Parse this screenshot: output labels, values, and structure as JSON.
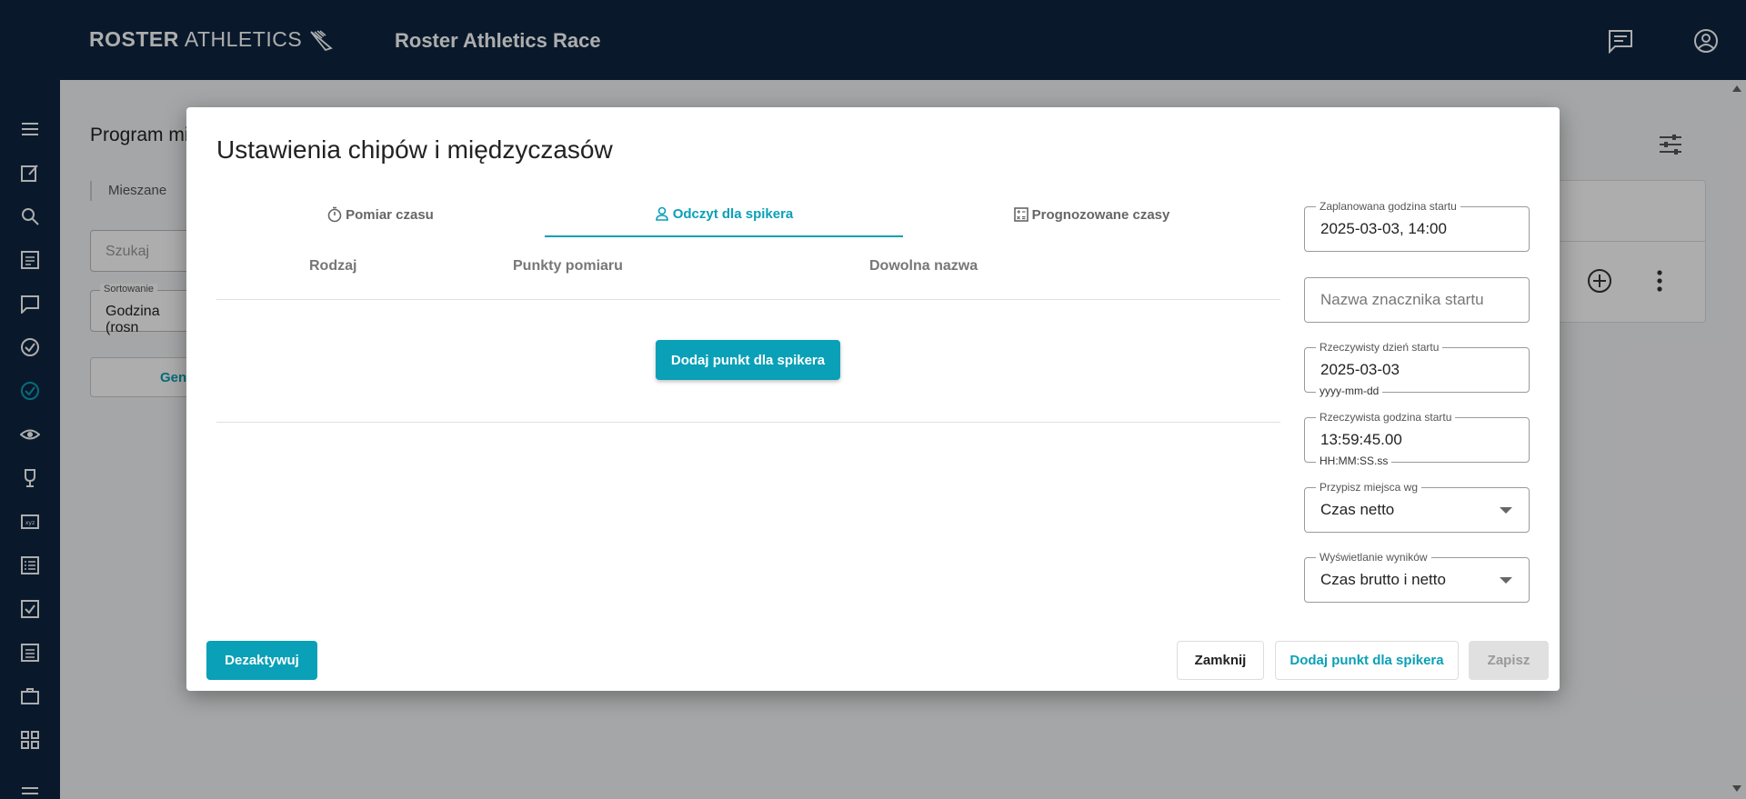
{
  "app": {
    "logo_bold": "ROSTER",
    "logo_light": "ATHLETICS",
    "race_title": "Roster Athletics Race"
  },
  "background": {
    "page_title": "Program mi",
    "tab_label": "Mieszane",
    "search_placeholder": "Szukaj",
    "sort_label": "Sortowanie",
    "sort_value": "Godzina (rosn",
    "generate_label": "Gene"
  },
  "modal": {
    "title": "Ustawienia chipów i międzyczasów",
    "tabs": [
      {
        "label": "Pomiar czasu",
        "icon": "stopwatch-icon",
        "active": false
      },
      {
        "label": "Odczyt dla spikera",
        "icon": "person-icon",
        "active": true
      },
      {
        "label": "Prognozowane czasy",
        "icon": "calculator-icon",
        "active": false
      }
    ],
    "columns": [
      "Rodzaj",
      "Punkty pomiaru",
      "Dowolna nazwa"
    ],
    "add_point_button": "Dodaj punkt dla spikera",
    "form": {
      "planned_start": {
        "label": "Zaplanowana godzina startu",
        "value": "2025-03-03, 14:00"
      },
      "start_marker": {
        "placeholder": "Nazwa znacznika startu"
      },
      "actual_day": {
        "label": "Rzeczywisty dzień startu",
        "value": "2025-03-03",
        "hint": "yyyy-mm-dd"
      },
      "actual_time": {
        "label": "Rzeczywista godzina startu",
        "value": "13:59:45.00",
        "hint": "HH:MM:SS.ss"
      },
      "assign_places": {
        "label": "Przypisz miejsca wg",
        "value": "Czas netto"
      },
      "results_display": {
        "label": "Wyświetlanie wyników",
        "value": "Czas brutto i netto"
      }
    },
    "footer": {
      "deactivate": "Dezaktywuj",
      "close": "Zamknij",
      "add_point": "Dodaj punkt dla spikera",
      "save": "Zapisz"
    }
  },
  "colors": {
    "navy": "#0e2540",
    "accent": "#0aa0b7"
  }
}
